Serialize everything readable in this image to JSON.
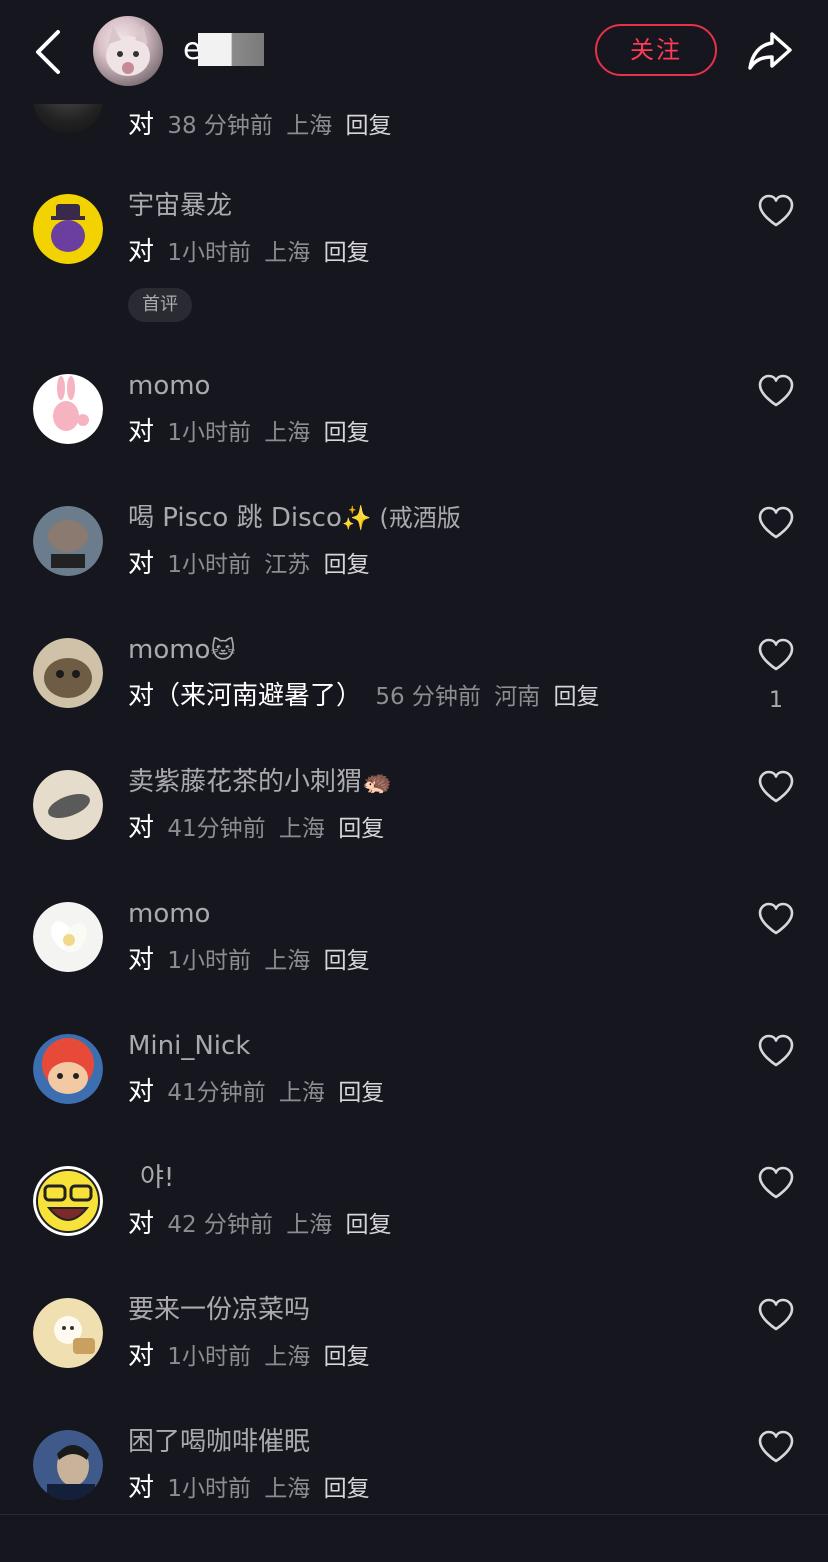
{
  "header": {
    "name_visible": "e",
    "follow_label": "关注",
    "back_icon": "chevron-left-icon",
    "share_icon": "share-arrow-icon"
  },
  "top_partial": {
    "reply": "对",
    "time": "38 分钟前",
    "location": "上海",
    "reply_label": "回复"
  },
  "comments": [
    {
      "username": "宇宙暴龙",
      "reply": "对",
      "time": "1小时前",
      "location": "上海",
      "reply_label": "回复",
      "tag": "首评",
      "like_count": ""
    },
    {
      "username": "momo",
      "reply": "对",
      "time": "1小时前",
      "location": "上海",
      "reply_label": "回复",
      "like_count": ""
    },
    {
      "username": "喝 Pisco 跳 Disco",
      "username_suffix": "✨ (戒酒版",
      "reply": "对",
      "time": "1小时前",
      "location": "江苏",
      "reply_label": "回复",
      "like_count": ""
    },
    {
      "username": "momo",
      "username_suffix": "🐱",
      "reply": "对（来河南避暑了）",
      "time": "56 分钟前",
      "location": "河南",
      "reply_label": "回复",
      "like_count": "1"
    },
    {
      "username": "卖紫藤花茶的小刺猬",
      "username_suffix": "🦔",
      "reply": "对",
      "time": "41分钟前",
      "location": "上海",
      "reply_label": "回复",
      "like_count": ""
    },
    {
      "username": "momo",
      "reply": "对",
      "time": "1小时前",
      "location": "上海",
      "reply_label": "回复",
      "like_count": ""
    },
    {
      "username": "Mini_Nick",
      "reply": "对",
      "time": "41分钟前",
      "location": "上海",
      "reply_label": "回复",
      "like_count": ""
    },
    {
      "username": "야!",
      "reply": "对",
      "time": "42 分钟前",
      "location": "上海",
      "reply_label": "回复",
      "like_count": ""
    },
    {
      "username": "要来一份凉菜吗",
      "reply": "对",
      "time": "1小时前",
      "location": "上海",
      "reply_label": "回复",
      "like_count": ""
    },
    {
      "username": "困了喝咖啡催眠",
      "reply": "对",
      "time": "1小时前",
      "location": "上海",
      "reply_label": "回复",
      "like_count": ""
    }
  ],
  "colors": {
    "background": "#16161e",
    "accent_red": "#ff3b55",
    "username_gray": "#a9a9ae",
    "meta_gray": "#8c8c92"
  }
}
